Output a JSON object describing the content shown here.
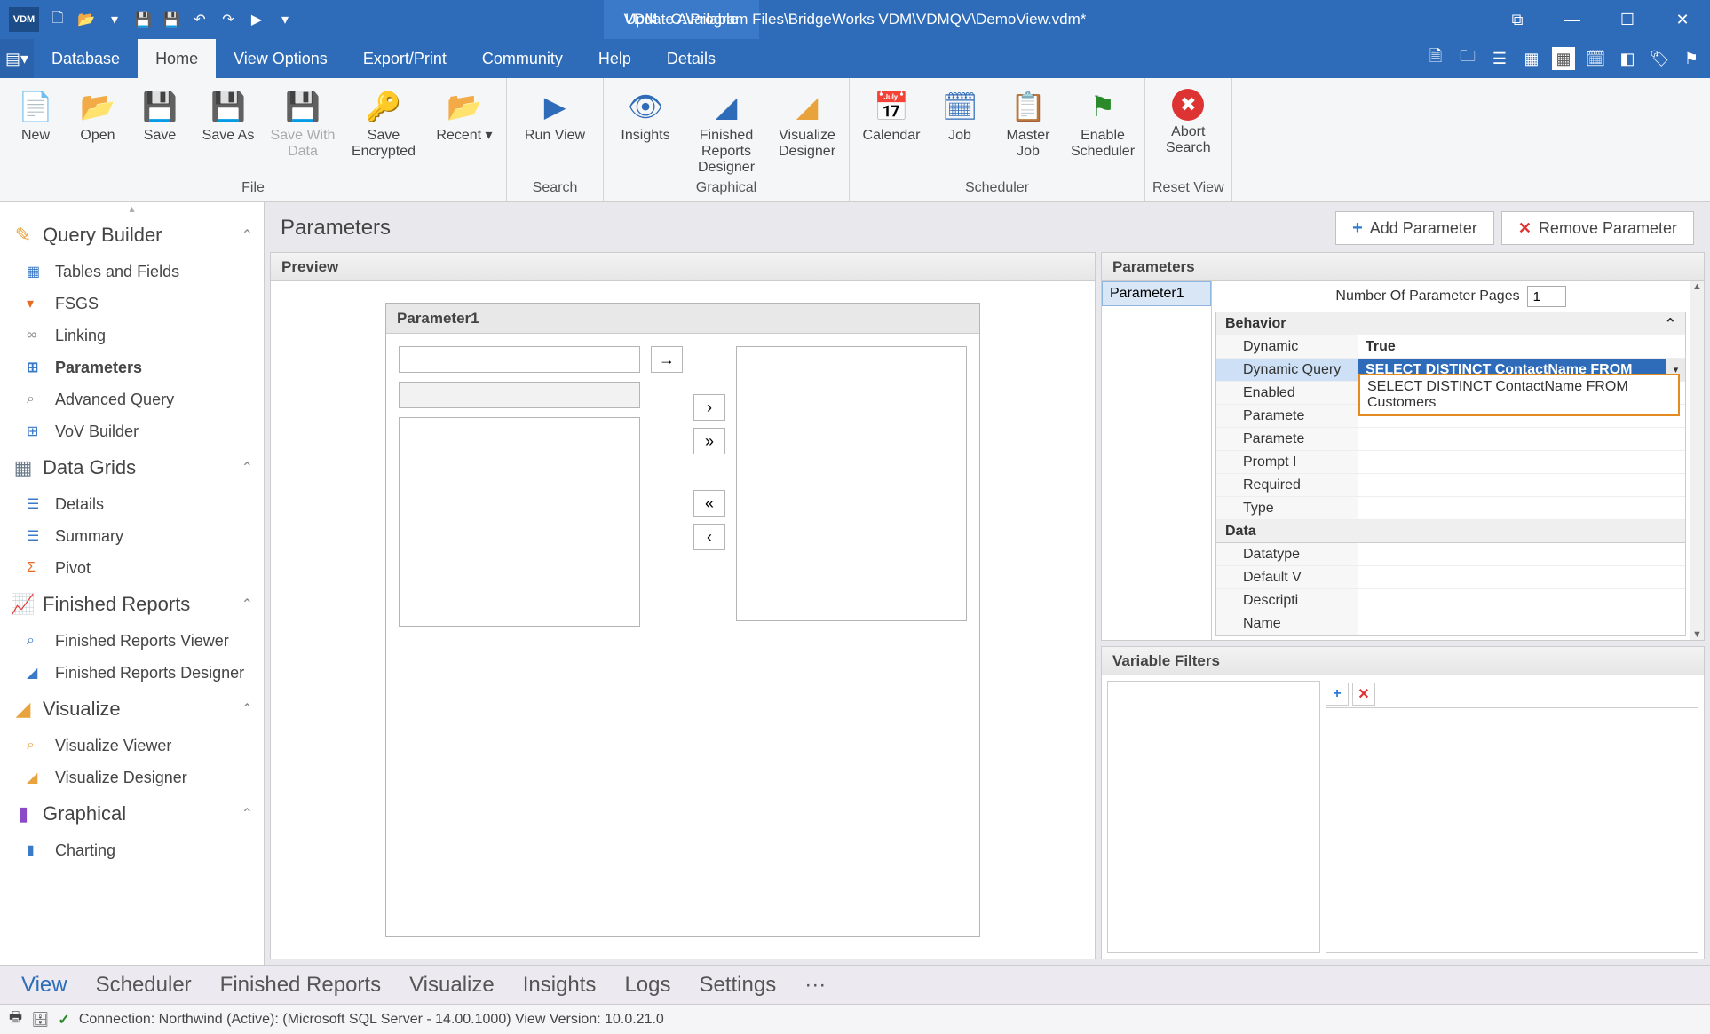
{
  "title": "VDM - C:\\Program Files\\BridgeWorks VDM\\VDMQV\\DemoView.vdm*",
  "update": "Update Available",
  "logo": "VDM",
  "menu": {
    "items": [
      "Database",
      "Home",
      "View Options",
      "Export/Print",
      "Community",
      "Help",
      "Details"
    ],
    "active": "Home"
  },
  "ribbon": {
    "groups": [
      {
        "name": "File",
        "buttons": [
          {
            "label": "New",
            "icon": "📄",
            "color": "#555",
            "cls": "narrow"
          },
          {
            "label": "Open",
            "icon": "📂",
            "color": "#e8a33d",
            "cls": "narrow"
          },
          {
            "label": "Save",
            "icon": "💾",
            "color": "#2e6bb8",
            "cls": "narrow"
          },
          {
            "label": "Save As",
            "icon": "💾",
            "color": "#2e6bb8",
            "badge": "+"
          },
          {
            "label": "Save With\nData",
            "icon": "💾",
            "color": "#bbb",
            "disabled": true
          },
          {
            "label": "Save Encrypted",
            "icon": "🔑",
            "color": "#e8a33d",
            "cls": "wide"
          },
          {
            "label": "Recent",
            "icon": "📂",
            "color": "#e8a33d",
            "drop": true
          }
        ]
      },
      {
        "name": "Search",
        "buttons": [
          {
            "label": "Run View",
            "icon": "▶",
            "color": "#2e6bb8",
            "cls": "wide"
          }
        ]
      },
      {
        "name": "Graphical",
        "buttons": [
          {
            "label": "Insights",
            "icon": "👁",
            "color": "#2e6bb8"
          },
          {
            "label": "Finished Reports\nDesigner",
            "icon": "◢",
            "color": "#2e6bb8",
            "cls": "wide"
          },
          {
            "label": "Visualize\nDesigner",
            "icon": "◢",
            "color": "#e8a33d"
          }
        ]
      },
      {
        "name": "Scheduler",
        "buttons": [
          {
            "label": "Calendar",
            "icon": "📅",
            "color": "#e8a33d"
          },
          {
            "label": "Job",
            "icon": "🗓",
            "color": "#2e6bb8",
            "cls": "narrow"
          },
          {
            "label": "Master\nJob",
            "icon": "📋",
            "color": "#e8a33d"
          },
          {
            "label": "Enable\nScheduler",
            "icon": "⚑",
            "color": "#2a8a2a"
          }
        ]
      },
      {
        "name": "Reset View",
        "buttons": [
          {
            "label": "Abort\nSearch",
            "icon": "✖",
            "color": "#d33",
            "round": true
          }
        ]
      }
    ]
  },
  "sidebar": {
    "sections": [
      {
        "title": "Query Builder",
        "icon": "✎",
        "color": "#e8a33d",
        "items": [
          {
            "label": "Tables and Fields",
            "icon": "▦",
            "color": "#3a7ac8"
          },
          {
            "label": "FSGS",
            "icon": "▾",
            "color": "#e86a1f"
          },
          {
            "label": "Linking",
            "icon": "∞",
            "color": "#888"
          },
          {
            "label": "Parameters",
            "icon": "⊞",
            "color": "#3a7ac8",
            "active": true
          },
          {
            "label": "Advanced Query",
            "icon": "⌕",
            "color": "#888"
          },
          {
            "label": "VoV Builder",
            "icon": "⊞",
            "color": "#3a7ac8"
          }
        ]
      },
      {
        "title": "Data Grids",
        "icon": "▦",
        "color": "#6b7a8a",
        "items": [
          {
            "label": "Details",
            "icon": "☰",
            "color": "#3a7ac8"
          },
          {
            "label": "Summary",
            "icon": "☰",
            "color": "#3a7ac8"
          },
          {
            "label": "Pivot",
            "icon": "Σ",
            "color": "#e86a1f"
          }
        ]
      },
      {
        "title": "Finished Reports",
        "icon": "📈",
        "color": "#3a7ac8",
        "items": [
          {
            "label": "Finished Reports Viewer",
            "icon": "⌕",
            "color": "#3a7ac8"
          },
          {
            "label": "Finished Reports Designer",
            "icon": "◢",
            "color": "#3a7ac8"
          }
        ]
      },
      {
        "title": "Visualize",
        "icon": "◢",
        "color": "#e8a33d",
        "items": [
          {
            "label": "Visualize Viewer",
            "icon": "⌕",
            "color": "#e8a33d"
          },
          {
            "label": "Visualize Designer",
            "icon": "◢",
            "color": "#e8a33d"
          }
        ]
      },
      {
        "title": "Graphical",
        "icon": "▮",
        "color": "#8a4ac8",
        "items": [
          {
            "label": "Charting",
            "icon": "▮",
            "color": "#3a7ac8"
          }
        ]
      }
    ]
  },
  "main": {
    "title": "Parameters",
    "add": "Add Parameter",
    "remove": "Remove Parameter",
    "preview": {
      "header": "Preview",
      "param_name": "Parameter1"
    }
  },
  "params_panel": {
    "header": "Parameters",
    "list": [
      "Parameter1"
    ],
    "pages_label": "Number Of Parameter Pages",
    "pages_value": "1",
    "group1": "Behavior",
    "group2": "Data",
    "rows_behavior": [
      {
        "label": "Dynamic",
        "value": "True",
        "bold": true
      },
      {
        "label": "Dynamic Query",
        "value": "SELECT DISTINCT ContactName FROM",
        "sel": true,
        "drop": true
      },
      {
        "label": "Enabled",
        "value": ""
      },
      {
        "label": "Paramete",
        "value": ""
      },
      {
        "label": "Paramete",
        "value": ""
      },
      {
        "label": "Prompt I",
        "value": ""
      },
      {
        "label": "Required",
        "value": ""
      },
      {
        "label": "Type",
        "value": ""
      }
    ],
    "rows_data": [
      {
        "label": "Datatype",
        "value": ""
      },
      {
        "label": "Default V",
        "value": ""
      },
      {
        "label": "Descripti",
        "value": ""
      },
      {
        "label": "Name",
        "value": ""
      }
    ],
    "autocomplete": "SELECT DISTINCT ContactName FROM Customers"
  },
  "vf": {
    "header": "Variable Filters"
  },
  "bottom": {
    "tabs": [
      "View",
      "Scheduler",
      "Finished Reports",
      "Visualize",
      "Insights",
      "Logs",
      "Settings",
      "···"
    ],
    "active": "View"
  },
  "status": "Connection: Northwind (Active): (Microsoft SQL Server - 14.00.1000) View Version: 10.0.21.0"
}
